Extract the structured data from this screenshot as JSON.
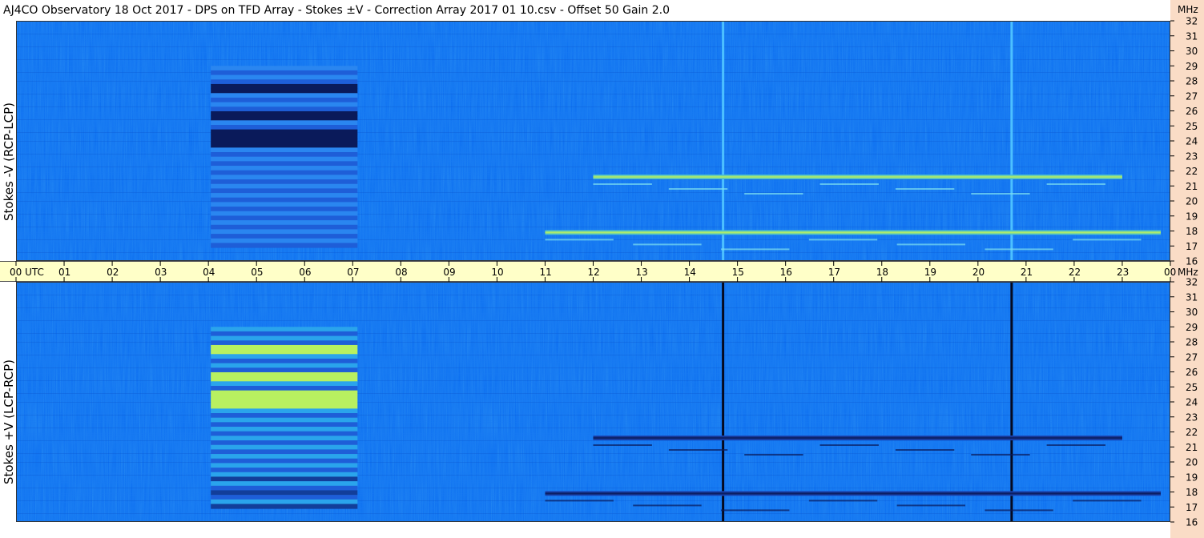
{
  "title": "AJ4CO Observatory  18 Oct 2017  -  DPS on TFD Array  -  Stokes ±V  -  Correction Array 2017 01 10.csv  -  Offset 50  Gain 2.0",
  "colors": {
    "background": "#0a6cf0",
    "time_axis_band": "#ffffc8",
    "right_strip": "#fadcc6",
    "dark_band": "#0a1a5a",
    "bright_band": "#b8f060"
  },
  "chart_data": [
    {
      "type": "heatmap",
      "panel": "top",
      "ylabel": "Stokes -V (RCP-LCP)",
      "x": [
        "00 UTC",
        "01",
        "02",
        "03",
        "04",
        "05",
        "06",
        "07",
        "08",
        "09",
        "10",
        "11",
        "12",
        "13",
        "14",
        "15",
        "16",
        "17",
        "18",
        "19",
        "20",
        "21",
        "22",
        "23",
        "00"
      ],
      "xunit": "",
      "y": [
        "32",
        "31",
        "30",
        "29",
        "28",
        "27",
        "26",
        "25",
        "24",
        "23",
        "22",
        "21",
        "20",
        "19",
        "18",
        "17",
        "16"
      ],
      "yunit": "MHz",
      "xlim": [
        0,
        24
      ],
      "ylim": [
        16,
        32
      ],
      "features": [
        {
          "kind": "block",
          "x0": 4.05,
          "x1": 7.1,
          "y0": 16.9,
          "y1": 29.0,
          "style": "dark"
        },
        {
          "kind": "vline",
          "x": 14.7,
          "style": "bright"
        },
        {
          "kind": "vline",
          "x": 20.7,
          "style": "bright"
        },
        {
          "kind": "band",
          "x0": 11.0,
          "x1": 23.8,
          "y": 17.9,
          "style": "bright"
        },
        {
          "kind": "band",
          "x0": 12.0,
          "x1": 23.0,
          "y": 21.6,
          "style": "bright"
        }
      ]
    },
    {
      "type": "heatmap",
      "panel": "bottom",
      "ylabel": "Stokes +V (LCP-RCP)",
      "x": [
        "00 UTC",
        "01",
        "02",
        "03",
        "04",
        "05",
        "06",
        "07",
        "08",
        "09",
        "10",
        "11",
        "12",
        "13",
        "14",
        "15",
        "16",
        "17",
        "18",
        "19",
        "20",
        "21",
        "22",
        "23",
        "00"
      ],
      "xunit": "MHz",
      "y": [
        "32",
        "31",
        "30",
        "29",
        "28",
        "27",
        "26",
        "25",
        "24",
        "23",
        "22",
        "21",
        "20",
        "19",
        "18",
        "17",
        "16"
      ],
      "yunit": "",
      "xlim": [
        0,
        24
      ],
      "ylim": [
        16,
        32
      ],
      "features": [
        {
          "kind": "block",
          "x0": 4.05,
          "x1": 7.1,
          "y0": 16.9,
          "y1": 29.0,
          "style": "bright"
        },
        {
          "kind": "vline",
          "x": 14.7,
          "style": "dark"
        },
        {
          "kind": "vline",
          "x": 20.7,
          "style": "dark"
        },
        {
          "kind": "band",
          "x0": 11.0,
          "x1": 23.8,
          "y": 17.9,
          "style": "dark"
        },
        {
          "kind": "band",
          "x0": 12.0,
          "x1": 23.0,
          "y": 21.6,
          "style": "dark"
        }
      ]
    }
  ]
}
